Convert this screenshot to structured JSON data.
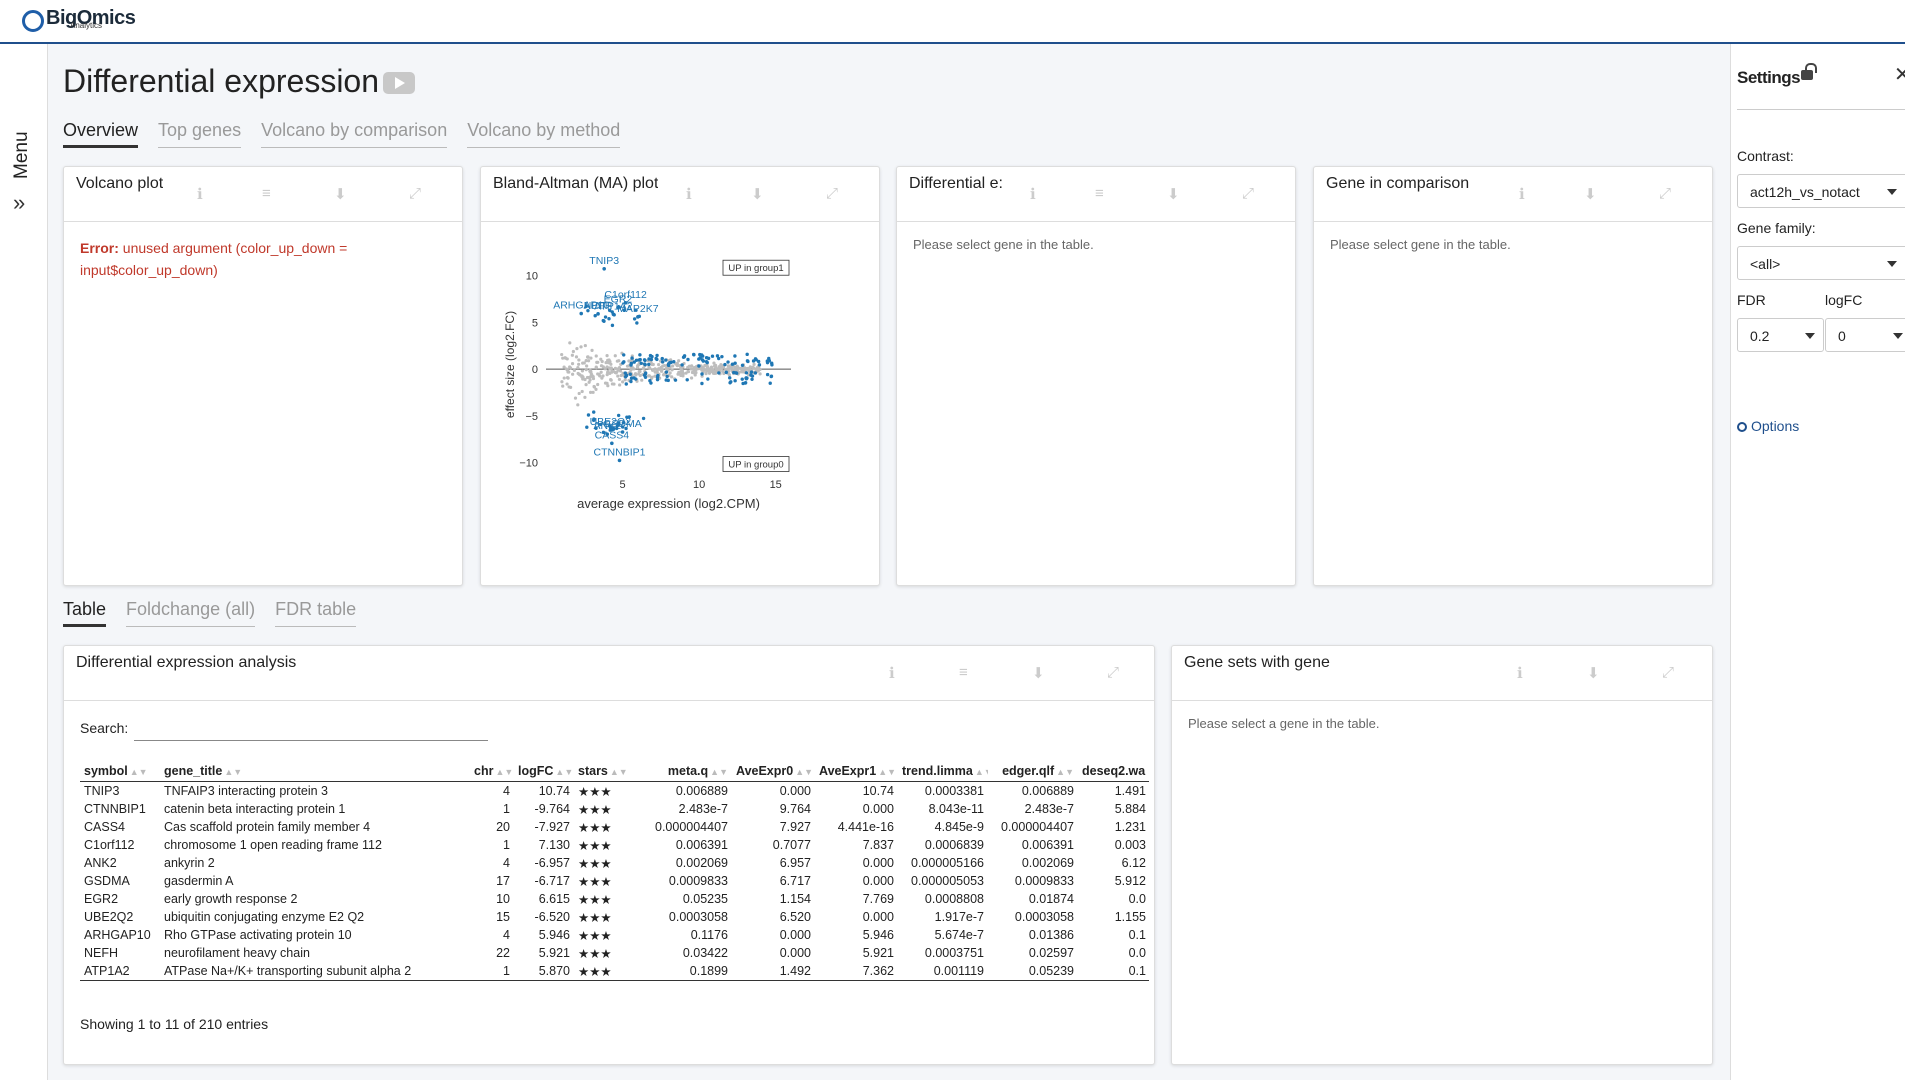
{
  "app": {
    "logo_text": "BigOmics",
    "logo_sub": "Analytics"
  },
  "sidebar": {
    "menu_label": "Menu"
  },
  "page": {
    "title": "Differential expression",
    "tabs": [
      "Overview",
      "Top genes",
      "Volcano by comparison",
      "Volcano by method"
    ],
    "bottom_tabs": [
      "Table",
      "Foldchange (all)",
      "FDR table"
    ]
  },
  "cards": {
    "volcano": {
      "title": "Volcano plot",
      "error_label": "Error:",
      "error_text": "unused argument (color_up_down = input$color_up_down)"
    },
    "ma": {
      "title": "Bland-Altman (MA) plot"
    },
    "diffexpr": {
      "title": "Differential e:",
      "msg": "Please select gene in the table."
    },
    "genecomp": {
      "title": "Gene in comparison",
      "msg": "Please select gene in the table."
    },
    "table": {
      "title": "Differential expression analysis",
      "search_label": "Search:",
      "info": "Showing 1 to 11 of 210 entries"
    },
    "genesets": {
      "title": "Gene sets with gene",
      "msg": "Please select a gene in the table."
    }
  },
  "chart_data": {
    "type": "scatter",
    "title": "",
    "xlabel": "average expression (log2.CPM)",
    "ylabel": "effect size (log2.FC)",
    "xlim": [
      0,
      16
    ],
    "ylim": [
      -11,
      12
    ],
    "xticks": [
      5,
      10,
      15
    ],
    "yticks": [
      10,
      5,
      0,
      -5,
      -10
    ],
    "annotations": [
      "UP in group1",
      "UP in group0"
    ],
    "colors": {
      "significant": "#1f77b4",
      "other": "#bdbdbd"
    },
    "labeled_points": [
      {
        "label": "TNIP3",
        "x": 3.8,
        "y": 10.74
      },
      {
        "label": "C1orf112",
        "x": 5.2,
        "y": 7.1
      },
      {
        "label": "EGR2",
        "x": 4.7,
        "y": 6.6
      },
      {
        "label": "ARHGAP10",
        "x": 2.3,
        "y": 5.95
      },
      {
        "label": "NEFH",
        "x": 3.4,
        "y": 5.92
      },
      {
        "label": "ATP1A2",
        "x": 4.4,
        "y": 5.87
      },
      {
        "label": "MAP2K7",
        "x": 6.0,
        "y": 5.6
      },
      {
        "label": "UBE2Q2",
        "x": 4.2,
        "y": -6.52
      },
      {
        "label": "GSDMA",
        "x": 5.0,
        "y": -6.72
      },
      {
        "label": "ANK2",
        "x": 4.0,
        "y": -6.96
      },
      {
        "label": "CASS4",
        "x": 4.3,
        "y": -7.93
      },
      {
        "label": "CTNNBIP1",
        "x": 4.8,
        "y": -9.76
      }
    ]
  },
  "table": {
    "columns": [
      "symbol",
      "gene_title",
      "chr",
      "logFC",
      "stars",
      "meta.q",
      "AveExpr0",
      "AveExpr1",
      "trend.limma",
      "edger.qlf",
      "deseq2.wa"
    ],
    "rows": [
      [
        "TNIP3",
        "TNFAIP3 interacting protein 3",
        "4",
        "10.74",
        "★★★",
        "0.006889",
        "0.000",
        "10.74",
        "0.0003381",
        "0.006889",
        "1.491"
      ],
      [
        "CTNNBIP1",
        "catenin beta interacting protein 1",
        "1",
        "-9.764",
        "★★★",
        "2.483e-7",
        "9.764",
        "0.000",
        "8.043e-11",
        "2.483e-7",
        "5.884"
      ],
      [
        "CASS4",
        "Cas scaffold protein family member 4",
        "20",
        "-7.927",
        "★★★",
        "0.000004407",
        "7.927",
        "4.441e-16",
        "4.845e-9",
        "0.000004407",
        "1.231"
      ],
      [
        "C1orf112",
        "chromosome 1 open reading frame 112",
        "1",
        "7.130",
        "★★★",
        "0.006391",
        "0.7077",
        "7.837",
        "0.0006839",
        "0.006391",
        "0.003"
      ],
      [
        "ANK2",
        "ankyrin 2",
        "4",
        "-6.957",
        "★★★",
        "0.002069",
        "6.957",
        "0.000",
        "0.000005166",
        "0.002069",
        "6.12"
      ],
      [
        "GSDMA",
        "gasdermin A",
        "17",
        "-6.717",
        "★★★",
        "0.0009833",
        "6.717",
        "0.000",
        "0.000005053",
        "0.0009833",
        "5.912"
      ],
      [
        "EGR2",
        "early growth response 2",
        "10",
        "6.615",
        "★★★",
        "0.05235",
        "1.154",
        "7.769",
        "0.0008808",
        "0.01874",
        "0.0"
      ],
      [
        "UBE2Q2",
        "ubiquitin conjugating enzyme E2 Q2",
        "15",
        "-6.520",
        "★★★",
        "0.0003058",
        "6.520",
        "0.000",
        "1.917e-7",
        "0.0003058",
        "1.155"
      ],
      [
        "ARHGAP10",
        "Rho GTPase activating protein 10",
        "4",
        "5.946",
        "★★★",
        "0.1176",
        "0.000",
        "5.946",
        "5.674e-7",
        "0.01386",
        "0.1"
      ],
      [
        "NEFH",
        "neurofilament heavy chain",
        "22",
        "5.921",
        "★★★",
        "0.03422",
        "0.000",
        "5.921",
        "0.0003751",
        "0.02597",
        "0.0"
      ],
      [
        "ATP1A2",
        "ATPase Na+/K+ transporting subunit alpha 2",
        "1",
        "5.870",
        "★★★",
        "0.1899",
        "1.492",
        "7.362",
        "0.001119",
        "0.05239",
        "0.1"
      ]
    ]
  },
  "settings": {
    "title": "Settings",
    "contrast_label": "Contrast:",
    "contrast_value": "act12h_vs_notact",
    "genefamily_label": "Gene family:",
    "genefamily_value": "<all>",
    "fdr_label": "FDR",
    "fdr_value": "0.2",
    "logfc_label": "logFC",
    "logfc_value": "0",
    "options_label": "Options"
  }
}
